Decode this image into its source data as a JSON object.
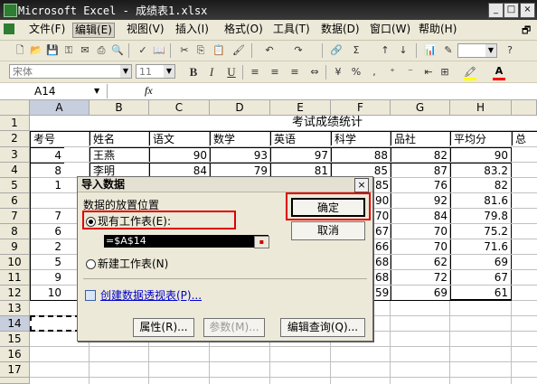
{
  "window": {
    "title": "Microsoft Excel - 成绩表1.xlsx",
    "min": "_",
    "max": "□",
    "close": "×"
  },
  "menu": {
    "items": [
      "文件(F)",
      "编辑(E)",
      "视图(V)",
      "插入(I)",
      "格式(O)",
      "工具(T)",
      "数据(D)",
      "窗口(W)",
      "帮助(H)"
    ],
    "selected_index": 1
  },
  "format_toolbar": {
    "font_name": "宋体",
    "font_size": "11",
    "bold": "B",
    "italic": "I",
    "underline": "U"
  },
  "formula_bar": {
    "name_box": "A14",
    "fx": "fx",
    "formula": ""
  },
  "sheet": {
    "columns": [
      "A",
      "B",
      "C",
      "D",
      "E",
      "F",
      "G",
      "H"
    ],
    "selected_column": "A",
    "rows": [
      "1",
      "2",
      "3",
      "4",
      "5",
      "6",
      "7",
      "8",
      "9",
      "10",
      "11",
      "12",
      "13",
      "14",
      "15",
      "16",
      "17"
    ],
    "selected_row": "14",
    "title": "考试成绩统计",
    "headers": [
      "考号",
      "姓名",
      "语文",
      "数学",
      "英语",
      "科学",
      "品社",
      "平均分",
      "总"
    ],
    "row3": [
      "4",
      "王燕",
      "90",
      "93",
      "97",
      "88",
      "82",
      "90"
    ],
    "row4": [
      "8",
      "李明",
      "84",
      "79",
      "81",
      "85",
      "87",
      "83.2"
    ],
    "visible_a": [
      "1",
      "7",
      "6",
      "2",
      "5",
      "9",
      "10"
    ],
    "visible_f": [
      "85",
      "90",
      "70",
      "67",
      "66",
      "68",
      "68",
      "59"
    ],
    "visible_g": [
      "76",
      "92",
      "84",
      "70",
      "70",
      "62",
      "72",
      "69"
    ],
    "visible_h": [
      "82",
      "81.6",
      "79.8",
      "75.2",
      "71.6",
      "69",
      "67",
      "61"
    ]
  },
  "dialog": {
    "title": "导入数据",
    "close": "×",
    "group_label": "数据的放置位置",
    "radio_existing": "现有工作表(E):",
    "ref_value": "=$A$14",
    "radio_new": "新建工作表(N)",
    "pivot_link": "创建数据透视表(P)...",
    "ok": "确定",
    "cancel": "取消",
    "properties": "属性(R)...",
    "parameters": "参数(M)...",
    "edit_query": "编辑查询(Q)..."
  }
}
